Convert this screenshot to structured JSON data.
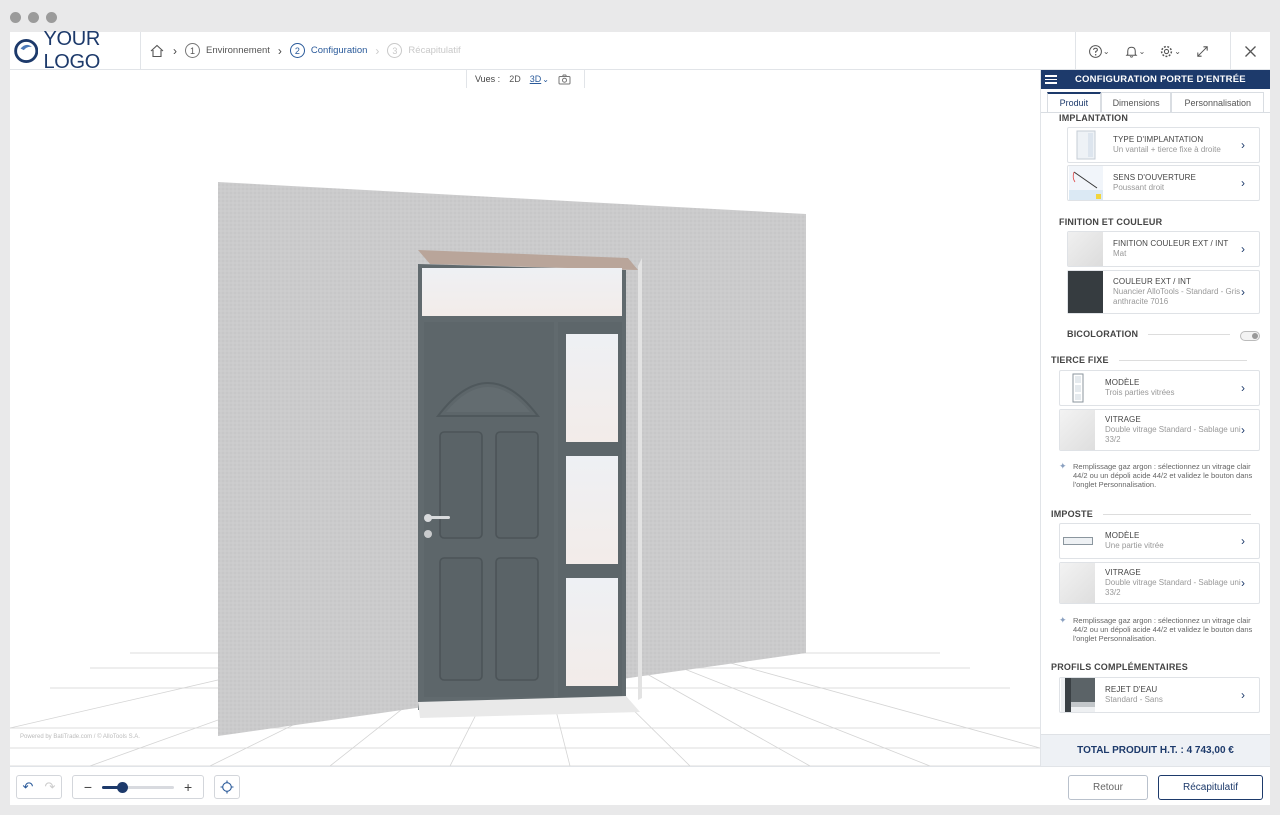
{
  "header": {
    "logo_text": "YOUR LOGO",
    "steps": [
      {
        "num": "1",
        "label": "Environnement"
      },
      {
        "num": "2",
        "label": "Configuration"
      },
      {
        "num": "3",
        "label": "Récapitulatif"
      }
    ]
  },
  "views": {
    "label": "Vues :",
    "opt_2d": "2D",
    "opt_3d": "3D"
  },
  "viewport": {
    "powered": "Powered by BatiTrade.com / © AlloTools S.A."
  },
  "panel": {
    "title": "CONFIGURATION PORTE D'ENTRÉE",
    "tabs": [
      "Produit",
      "Dimensions",
      "Personnalisation"
    ],
    "sections": {
      "implantation": "IMPLANTATION",
      "finition": "FINITION ET COULEUR",
      "tierce": "TIERCE FIXE",
      "imposte": "IMPOSTE",
      "profils": "PROFILS COMPLÉMENTAIRES"
    },
    "options": {
      "type_implantation": {
        "label": "TYPE D'IMPLANTATION",
        "value": "Un vantail + tierce fixe à droite"
      },
      "sens_ouverture": {
        "label": "SENS D'OUVERTURE",
        "value": "Poussant droit"
      },
      "finition_couleur": {
        "label": "FINITION COULEUR EXT / INT",
        "value": "Mat"
      },
      "couleur": {
        "label": "COULEUR EXT / INT",
        "value": "Nuancier AlloTools - Standard - Gris anthracite 7016"
      },
      "tierce_modele": {
        "label": "MODÈLE",
        "value": "Trois parties vitrées"
      },
      "tierce_vitrage": {
        "label": "VITRAGE",
        "value": "Double vitrage Standard - Sablage uni 33/2"
      },
      "imposte_modele": {
        "label": "MODÈLE",
        "value": "Une partie vitrée"
      },
      "imposte_vitrage": {
        "label": "VITRAGE",
        "value": "Double vitrage Standard - Sablage uni 33/2"
      },
      "rejet": {
        "label": "REJET D'EAU",
        "value": "Standard - Sans"
      }
    },
    "bicoloration": "BICOLORATION",
    "note": "Remplissage gaz argon : sélectionnez un vitrage clair 44/2 ou un dépoli acide 44/2 et validez le bouton dans l'onglet Personnalisation.",
    "total": "TOTAL PRODUIT H.T. : 4 743,00 €"
  },
  "bottom": {
    "retour": "Retour",
    "recap": "Récapitulatif",
    "zoom_level": 0.28
  },
  "colors": {
    "brand": "#1d3a6b",
    "door": "#5f686c",
    "wall": "#cbcbcc"
  }
}
